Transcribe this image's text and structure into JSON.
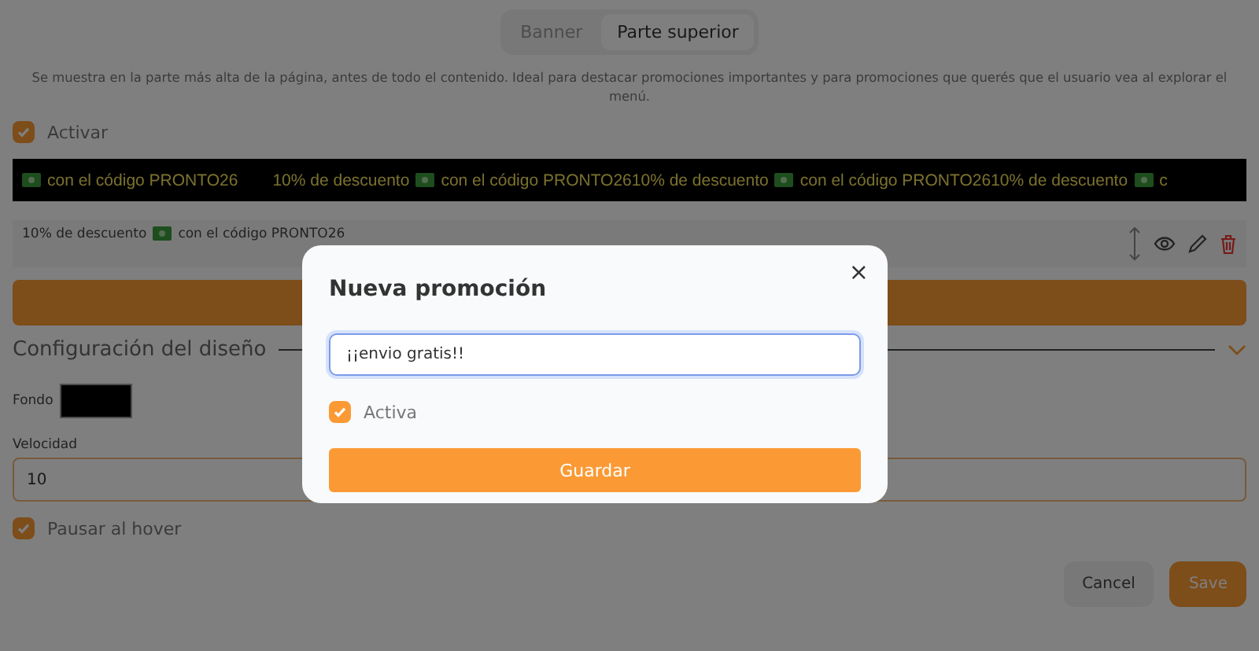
{
  "tabs": [
    {
      "label": "Banner",
      "selected": false
    },
    {
      "label": "Parte superior",
      "selected": true
    }
  ],
  "description": "Se muestra en la parte más alta de la página, antes de todo el contenido. Ideal para destacar promociones importantes y para promociones que querés que el usuario vea al explorar el menú.",
  "activate": {
    "label": "Activar",
    "checked": true
  },
  "ticker": [
    {
      "text": "con el código PRONTO26",
      "icon": true
    },
    {
      "text": "10% de descuento",
      "icon": false
    },
    {
      "text": "con el código PRONTO2610% de descuento",
      "icon": true
    },
    {
      "text": "con el código PRONTO2610% de descuento",
      "icon": true
    },
    {
      "text": "c",
      "icon": true
    }
  ],
  "promotions": [
    {
      "before": "10% de descuento",
      "after": "con el código PRONTO26"
    }
  ],
  "design_section": {
    "title": "Configuración del diseño",
    "expanded": true
  },
  "background": {
    "label": "Fondo",
    "color": "#000000"
  },
  "speed": {
    "label": "Velocidad",
    "value": "10"
  },
  "pause_on_hover": {
    "label": "Pausar al hover",
    "checked": true
  },
  "footer_buttons": [
    "Cancel",
    "Save"
  ],
  "modal": {
    "title": "Nueva promoción",
    "close": "×",
    "input_value": "¡¡envio gratis!!",
    "active": {
      "label": "Activa",
      "checked": true
    },
    "submit": "Guardar"
  }
}
